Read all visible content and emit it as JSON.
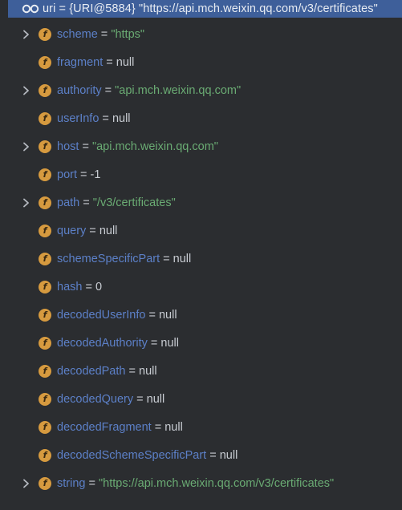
{
  "root": {
    "label": "uri = {URI@5884} \"https://api.mch.weixin.qq.com/v3/certificates\""
  },
  "fields": [
    {
      "name": "scheme",
      "value": "\"https\"",
      "kind": "string",
      "expandable": true
    },
    {
      "name": "fragment",
      "value": "null",
      "kind": "null",
      "expandable": false
    },
    {
      "name": "authority",
      "value": "\"api.mch.weixin.qq.com\"",
      "kind": "string",
      "expandable": true
    },
    {
      "name": "userInfo",
      "value": "null",
      "kind": "null",
      "expandable": false
    },
    {
      "name": "host",
      "value": "\"api.mch.weixin.qq.com\"",
      "kind": "string",
      "expandable": true
    },
    {
      "name": "port",
      "value": "-1",
      "kind": "number",
      "expandable": false
    },
    {
      "name": "path",
      "value": "\"/v3/certificates\"",
      "kind": "string",
      "expandable": true
    },
    {
      "name": "query",
      "value": "null",
      "kind": "null",
      "expandable": false
    },
    {
      "name": "schemeSpecificPart",
      "value": "null",
      "kind": "null",
      "expandable": false
    },
    {
      "name": "hash",
      "value": "0",
      "kind": "number",
      "expandable": false
    },
    {
      "name": "decodedUserInfo",
      "value": "null",
      "kind": "null",
      "expandable": false
    },
    {
      "name": "decodedAuthority",
      "value": "null",
      "kind": "null",
      "expandable": false
    },
    {
      "name": "decodedPath",
      "value": "null",
      "kind": "null",
      "expandable": false
    },
    {
      "name": "decodedQuery",
      "value": "null",
      "kind": "null",
      "expandable": false
    },
    {
      "name": "decodedFragment",
      "value": "null",
      "kind": "null",
      "expandable": false
    },
    {
      "name": "decodedSchemeSpecificPart",
      "value": "null",
      "kind": "null",
      "expandable": false
    },
    {
      "name": "string",
      "value": "\"https://api.mch.weixin.qq.com/v3/certificates\"",
      "kind": "string",
      "expandable": true
    }
  ],
  "icons": {
    "root": "watch-glasses-icon",
    "field": "field-icon",
    "field_letter": "f",
    "expand": "chevron-right-icon"
  },
  "colors": {
    "background": "#2b2d30",
    "selection": "#3e5f9a",
    "field_name": "#5c80c8",
    "string_value": "#6aab73",
    "plain_value": "#c8ccd2",
    "field_icon": "#d69a3f"
  }
}
